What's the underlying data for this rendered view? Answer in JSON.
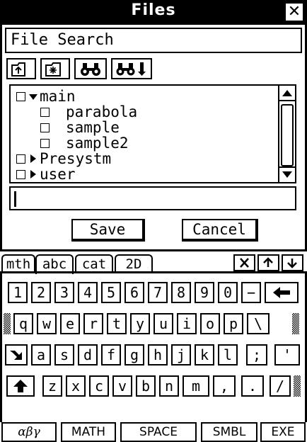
{
  "window": {
    "title": "Files"
  },
  "dialog": {
    "heading": "File Search",
    "tree": [
      {
        "label": "main",
        "kind": "folder",
        "expanded": true
      },
      {
        "label": "parabola",
        "kind": "file"
      },
      {
        "label": "sample",
        "kind": "file"
      },
      {
        "label": "sample2",
        "kind": "file"
      },
      {
        "label": "Presystm",
        "kind": "folder",
        "expanded": false
      },
      {
        "label": "user",
        "kind": "folder",
        "expanded": false
      }
    ],
    "filename_value": "",
    "buttons": {
      "save": "Save",
      "cancel": "Cancel"
    }
  },
  "keyboard": {
    "tabs": [
      "mth",
      "abc",
      "cat",
      "2D"
    ],
    "active_tab": "abc",
    "rows": [
      [
        "1",
        "2",
        "3",
        "4",
        "5",
        "6",
        "7",
        "8",
        "9",
        "0",
        "−"
      ],
      [
        "q",
        "w",
        "e",
        "r",
        "t",
        "y",
        "u",
        "i",
        "o",
        "p",
        "\\"
      ],
      [
        "a",
        "s",
        "d",
        "f",
        "g",
        "h",
        "j",
        "k",
        "l",
        ";",
        "'"
      ],
      [
        "z",
        "x",
        "c",
        "v",
        "b",
        "n",
        "m",
        ",",
        ".",
        "/"
      ]
    ],
    "modes": [
      "αβγ",
      "MATH",
      "SPACE",
      "SMBL",
      "EXE"
    ]
  }
}
